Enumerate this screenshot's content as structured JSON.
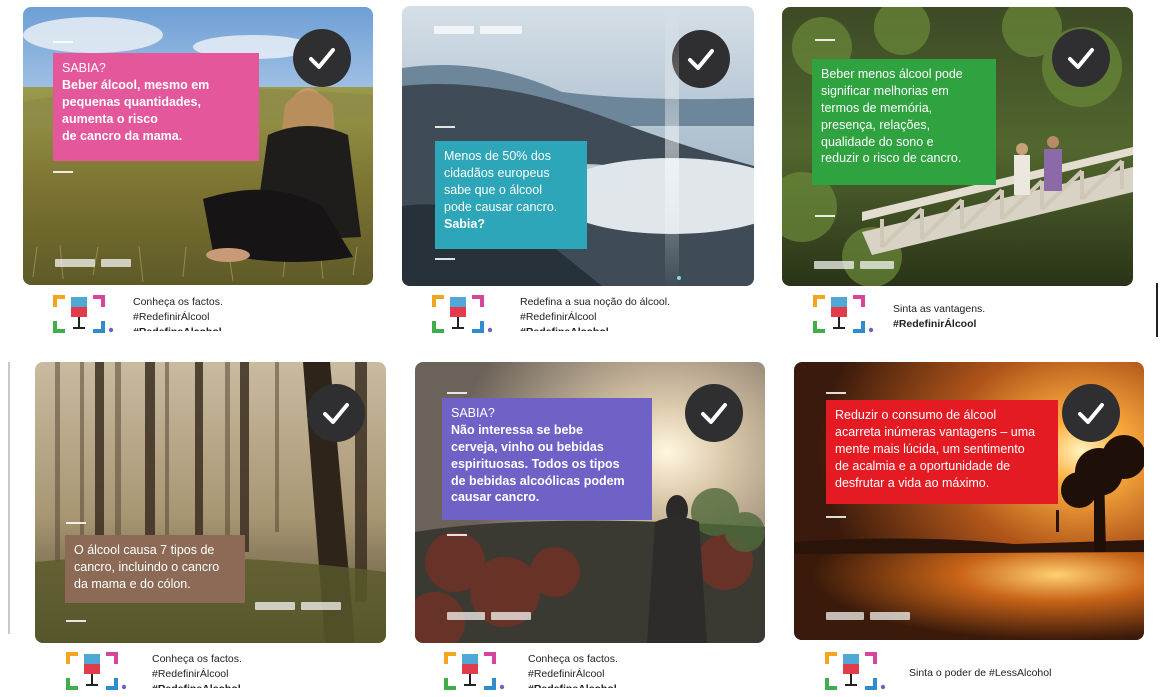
{
  "colors": {
    "pink": "#e4579b",
    "teal": "#2ca6b8",
    "green": "#2fa33f",
    "brown": "#8d6a55",
    "purple": "#6f62c6",
    "red": "#e51b24",
    "check_bg": "#2f2f31"
  },
  "cards": [
    {
      "id": "card-1",
      "lines": [
        "SABIA?",
        "Beber álcool, mesmo em",
        "pequenas quantidades,",
        "aumenta o risco",
        "de cancro da mama."
      ],
      "footer": {
        "line1": "Conheça os factos.",
        "hashtag1": "#RedefinirÁlcool",
        "hashtag2": "#RedefineAlcohol"
      }
    },
    {
      "id": "card-2",
      "lines": [
        "Menos de 50% dos",
        "cidadãos europeus",
        "sabe que o álcool",
        "pode causar cancro."
      ],
      "emphasis": "Sabia?",
      "footer": {
        "line1": "Redefina a sua noção do álcool.",
        "hashtag1": "#RedefinirÁlcool",
        "hashtag2": "#RedefineAlcohol"
      }
    },
    {
      "id": "card-3",
      "lines": [
        "Beber menos álcool pode",
        "significar melhorias em",
        "termos de memória,",
        "presença, relações,",
        "qualidade do sono e",
        "reduzir o risco de cancro."
      ],
      "footer": {
        "line1": "Sinta as vantagens.",
        "hashtag1": "#RedefinirÁlcool"
      }
    },
    {
      "id": "card-4",
      "lines": [
        "O álcool causa 7 tipos de",
        "cancro, incluindo o cancro",
        "da mama e do cólon."
      ],
      "footer": {
        "line1": "Conheça os factos.",
        "hashtag1": "#RedefinirÁlcool",
        "hashtag2": "#RedefineAlcohol"
      }
    },
    {
      "id": "card-5",
      "lines": [
        "SABIA?",
        "Não interessa se bebe",
        "cerveja, vinho ou bebidas",
        "espirituosas. Todos os tipos",
        "de bebidas alcoólicas podem",
        "causar cancro."
      ],
      "footer": {
        "line1": "Conheça os factos.",
        "hashtag1": "#RedefinirÁlcool",
        "hashtag2": "#RedefineAlcohol"
      }
    },
    {
      "id": "card-6",
      "lines": [
        "Reduzir o consumo de álcool",
        "acarreta inúmeras vantagens – uma",
        "mente mais lúcida, um sentimento",
        "de acalmia e a oportunidade de",
        "desfrutar a vida ao máximo."
      ],
      "footer": {
        "line1": "Sinta o poder de #LessAlcohol"
      }
    }
  ]
}
